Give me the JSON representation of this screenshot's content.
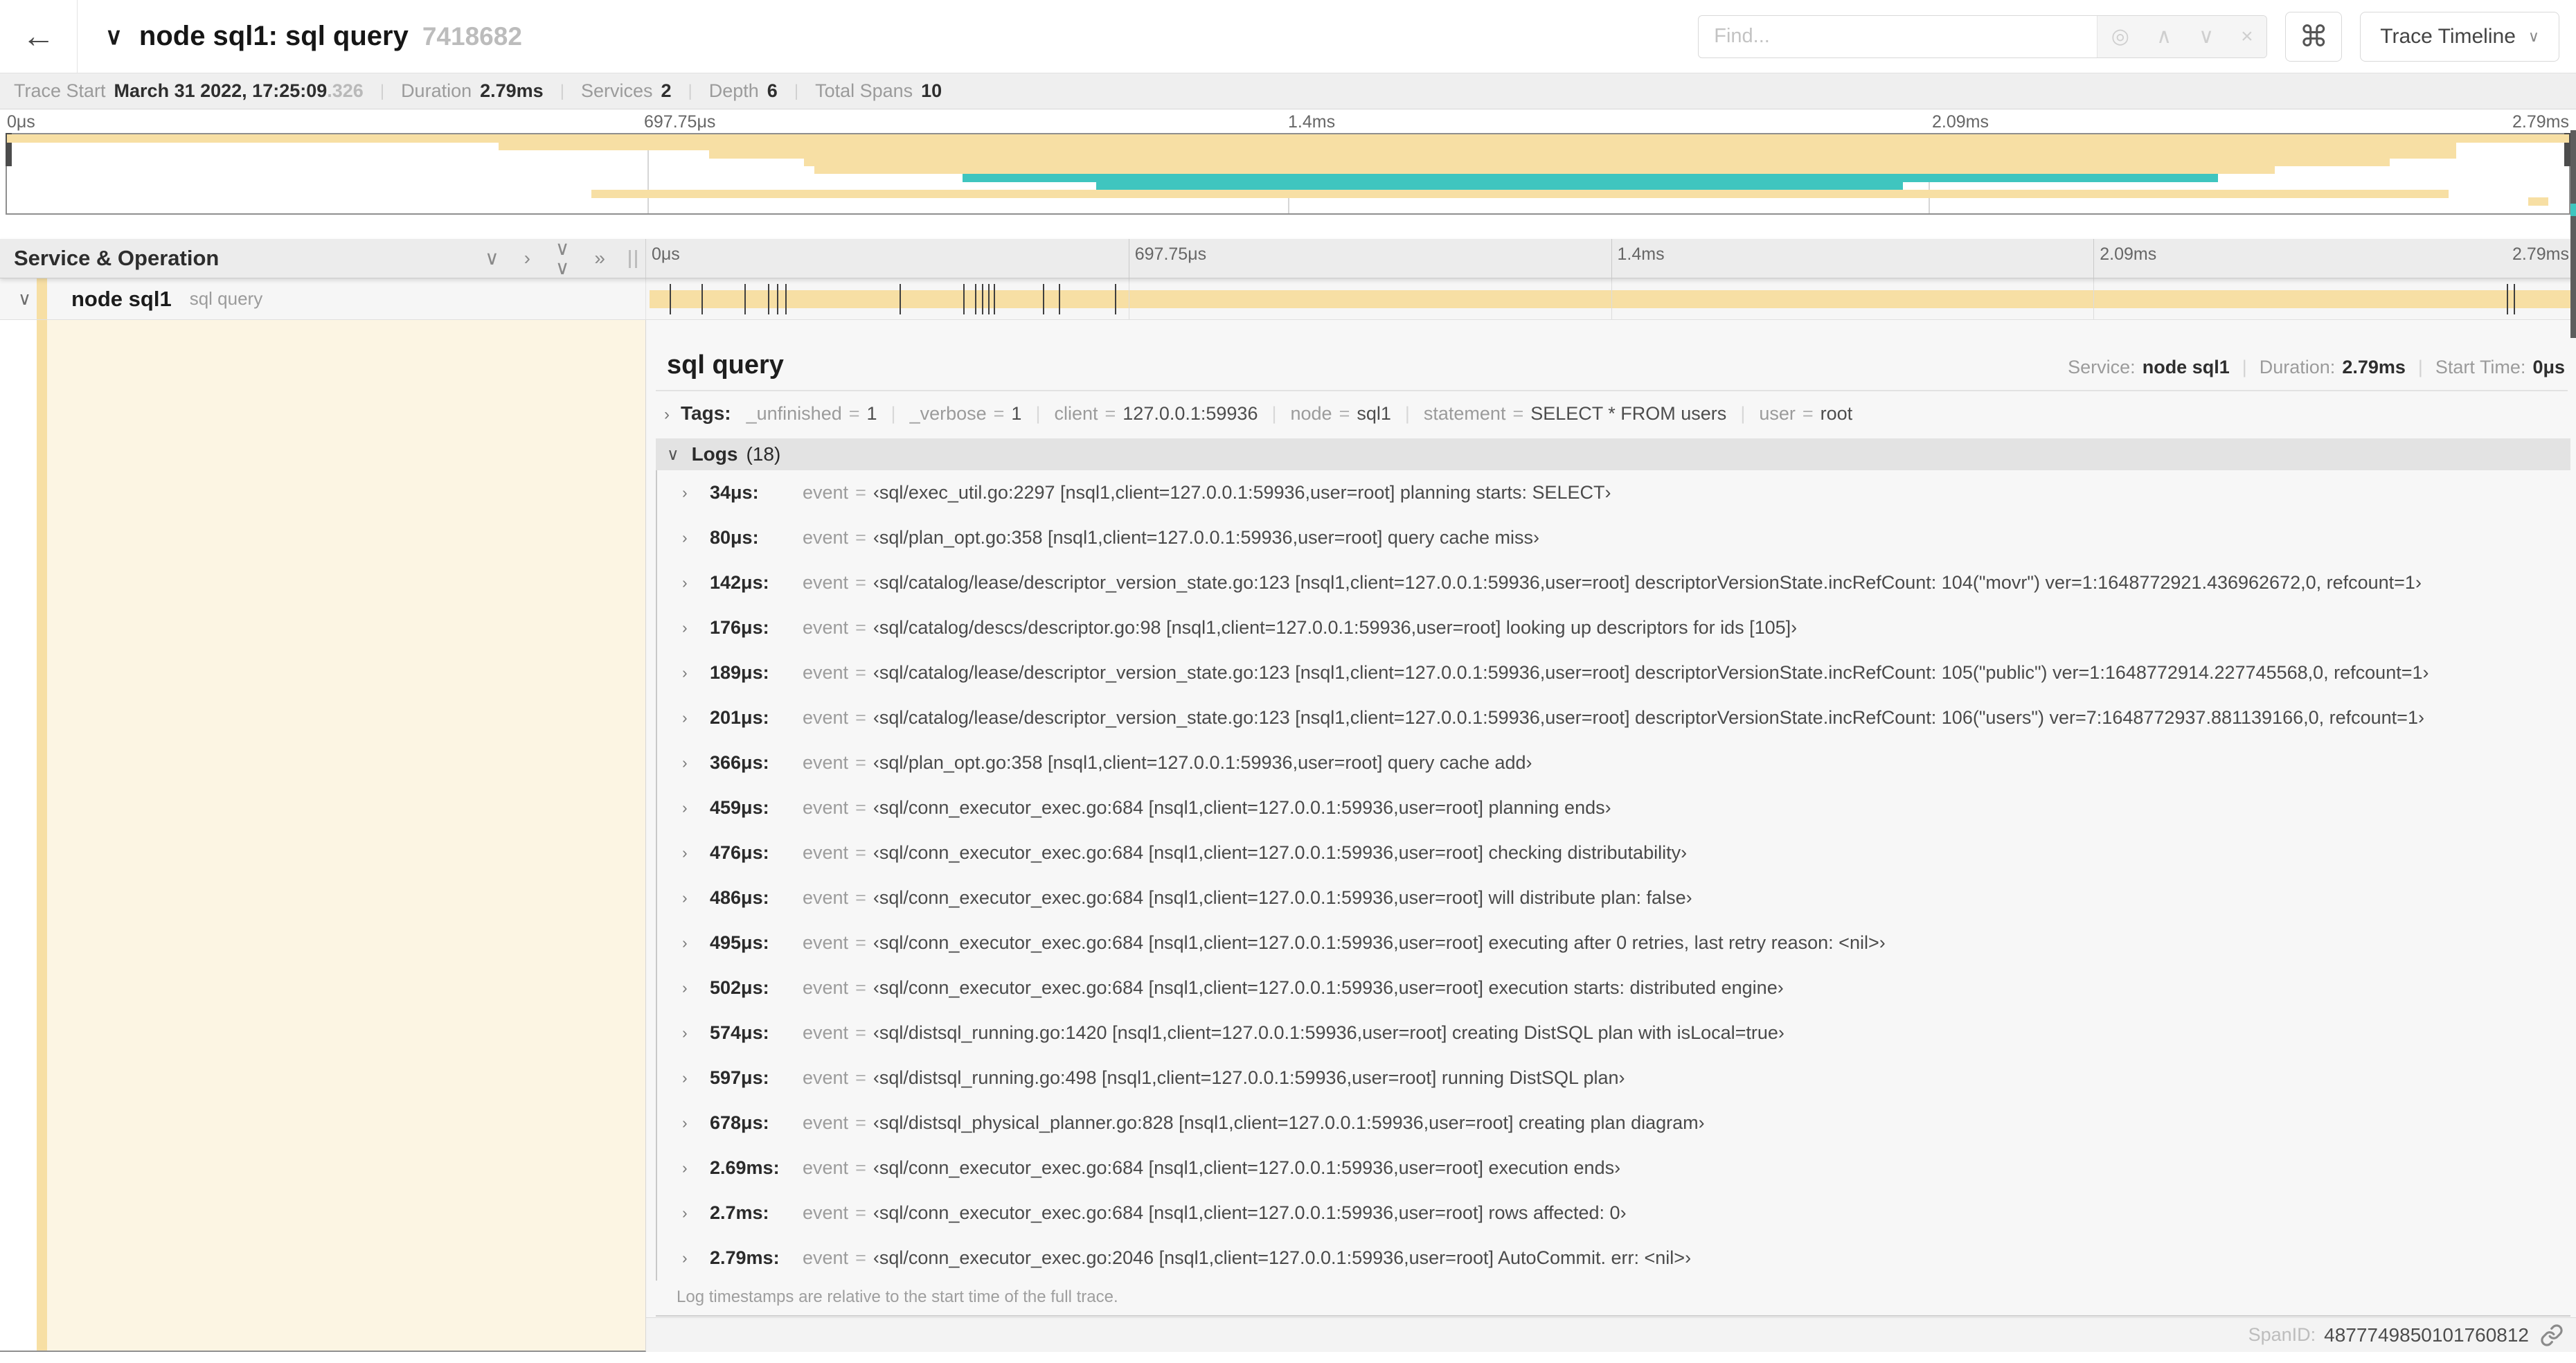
{
  "colors": {
    "tan": "#f7dfa4",
    "teal": "#3fc5bf",
    "cream": "#fcf5e3",
    "tick": "#3f3f3f"
  },
  "header": {
    "back_icon": "←",
    "collapse_icon": "∨",
    "title": "node sql1: sql query",
    "trace_id_short": "7418682",
    "find_placeholder": "Find...",
    "icons": {
      "locate": "◎",
      "prev": "∧",
      "next": "∨",
      "clear": "×",
      "command": "⌘",
      "dropdown": "∨"
    },
    "view_selector_label": "Trace Timeline"
  },
  "summary": {
    "items": [
      {
        "label": "Trace Start",
        "value": "March 31 2022, 17:25:09",
        "suffix": ".326"
      },
      {
        "label": "Duration",
        "value": "2.79ms",
        "suffix": ""
      },
      {
        "label": "Services",
        "value": "2",
        "suffix": ""
      },
      {
        "label": "Depth",
        "value": "6",
        "suffix": ""
      },
      {
        "label": "Total Spans",
        "value": "10",
        "suffix": ""
      }
    ]
  },
  "minimap": {
    "spans": [
      {
        "row": 0,
        "start": 0,
        "end": 100,
        "color": "tan"
      },
      {
        "row": 1,
        "start": 19.2,
        "end": 95.6,
        "color": "tan"
      },
      {
        "row": 2,
        "start": 27.4,
        "end": 95.6,
        "color": "tan"
      },
      {
        "row": 3,
        "start": 31.1,
        "end": 93.0,
        "color": "tan"
      },
      {
        "row": 4,
        "start": 31.5,
        "end": 88.5,
        "color": "tan"
      },
      {
        "row": 5,
        "start": 37.3,
        "end": 86.3,
        "color": "teal"
      },
      {
        "row": 6,
        "start": 42.5,
        "end": 74.0,
        "color": "teal"
      },
      {
        "row": 7,
        "start": 22.8,
        "end": 95.3,
        "color": "tan"
      },
      {
        "row": 8,
        "start": 98.4,
        "end": 99.2,
        "color": "tan"
      }
    ]
  },
  "timeline": {
    "section_title": "Service & Operation",
    "icons": {
      "collapse_one": "∨",
      "expand_one": "›",
      "collapse_all": "∨",
      "expand_all": "»"
    },
    "ticks": [
      "0μs",
      "697.75μs",
      "1.4ms",
      "2.09ms",
      "2.79ms"
    ],
    "gridline_pcts": [
      25,
      50,
      75
    ],
    "row": {
      "service": "node sql1",
      "operation": "sql query",
      "expander_icon": "∨",
      "log_marker_pcts": [
        1.22,
        2.87,
        5.09,
        6.31,
        6.77,
        7.2,
        13.12,
        16.45,
        17.06,
        17.42,
        17.74,
        18.0,
        20.57,
        21.4,
        24.3,
        96.42,
        96.77,
        99.85
      ]
    }
  },
  "detail": {
    "title": "sql query",
    "meta": [
      {
        "label": "Service:",
        "value": "node sql1"
      },
      {
        "label": "Duration:",
        "value": "2.79ms"
      },
      {
        "label": "Start Time:",
        "value": "0μs"
      }
    ],
    "tags_chevron": "›",
    "tags_title": "Tags:",
    "tags": [
      {
        "key": "_unfinished",
        "value": "1"
      },
      {
        "key": "_verbose",
        "value": "1"
      },
      {
        "key": "client",
        "value": "127.0.0.1:59936"
      },
      {
        "key": "node",
        "value": "sql1"
      },
      {
        "key": "statement",
        "value": "SELECT * FROM users"
      },
      {
        "key": "user",
        "value": "root"
      }
    ],
    "logs_chevron": "∨",
    "logs_title": "Logs",
    "logs_count": "(18)",
    "log_row_chevron": "›",
    "logs": [
      {
        "time": "34μs:",
        "field": "event",
        "value": "‹sql/exec_util.go:2297 [nsql1,client=127.0.0.1:59936,user=root] planning starts: SELECT›"
      },
      {
        "time": "80μs:",
        "field": "event",
        "value": "‹sql/plan_opt.go:358 [nsql1,client=127.0.0.1:59936,user=root] query cache miss›"
      },
      {
        "time": "142μs:",
        "field": "event",
        "value": "‹sql/catalog/lease/descriptor_version_state.go:123 [nsql1,client=127.0.0.1:59936,user=root] descriptorVersionState.incRefCount: 104(\"movr\") ver=1:1648772921.436962672,0, refcount=1›"
      },
      {
        "time": "176μs:",
        "field": "event",
        "value": "‹sql/catalog/descs/descriptor.go:98 [nsql1,client=127.0.0.1:59936,user=root] looking up descriptors for ids [105]›"
      },
      {
        "time": "189μs:",
        "field": "event",
        "value": "‹sql/catalog/lease/descriptor_version_state.go:123 [nsql1,client=127.0.0.1:59936,user=root] descriptorVersionState.incRefCount: 105(\"public\") ver=1:1648772914.227745568,0, refcount=1›"
      },
      {
        "time": "201μs:",
        "field": "event",
        "value": "‹sql/catalog/lease/descriptor_version_state.go:123 [nsql1,client=127.0.0.1:59936,user=root] descriptorVersionState.incRefCount: 106(\"users\") ver=7:1648772937.881139166,0, refcount=1›"
      },
      {
        "time": "366μs:",
        "field": "event",
        "value": "‹sql/plan_opt.go:358 [nsql1,client=127.0.0.1:59936,user=root] query cache add›"
      },
      {
        "time": "459μs:",
        "field": "event",
        "value": "‹sql/conn_executor_exec.go:684 [nsql1,client=127.0.0.1:59936,user=root] planning ends›"
      },
      {
        "time": "476μs:",
        "field": "event",
        "value": "‹sql/conn_executor_exec.go:684 [nsql1,client=127.0.0.1:59936,user=root] checking distributability›"
      },
      {
        "time": "486μs:",
        "field": "event",
        "value": "‹sql/conn_executor_exec.go:684 [nsql1,client=127.0.0.1:59936,user=root] will distribute plan: false›"
      },
      {
        "time": "495μs:",
        "field": "event",
        "value": "‹sql/conn_executor_exec.go:684 [nsql1,client=127.0.0.1:59936,user=root] executing after 0 retries, last retry reason: <nil>›"
      },
      {
        "time": "502μs:",
        "field": "event",
        "value": "‹sql/conn_executor_exec.go:684 [nsql1,client=127.0.0.1:59936,user=root] execution starts: distributed engine›"
      },
      {
        "time": "574μs:",
        "field": "event",
        "value": "‹sql/distsql_running.go:1420 [nsql1,client=127.0.0.1:59936,user=root] creating DistSQL plan with isLocal=true›"
      },
      {
        "time": "597μs:",
        "field": "event",
        "value": "‹sql/distsql_running.go:498 [nsql1,client=127.0.0.1:59936,user=root] running DistSQL plan›"
      },
      {
        "time": "678μs:",
        "field": "event",
        "value": "‹sql/distsql_physical_planner.go:828 [nsql1,client=127.0.0.1:59936,user=root] creating plan diagram›"
      },
      {
        "time": "2.69ms:",
        "field": "event",
        "value": "‹sql/conn_executor_exec.go:684 [nsql1,client=127.0.0.1:59936,user=root] execution ends›"
      },
      {
        "time": "2.7ms:",
        "field": "event",
        "value": "‹sql/conn_executor_exec.go:684 [nsql1,client=127.0.0.1:59936,user=root] rows affected: 0›"
      },
      {
        "time": "2.79ms:",
        "field": "event",
        "value": "‹sql/conn_executor_exec.go:2046 [nsql1,client=127.0.0.1:59936,user=root] AutoCommit. err: <nil>›"
      }
    ],
    "footnote": "Log timestamps are relative to the start time of the full trace.",
    "footer": {
      "label": "SpanID:",
      "value": "4877749850101760812"
    }
  }
}
